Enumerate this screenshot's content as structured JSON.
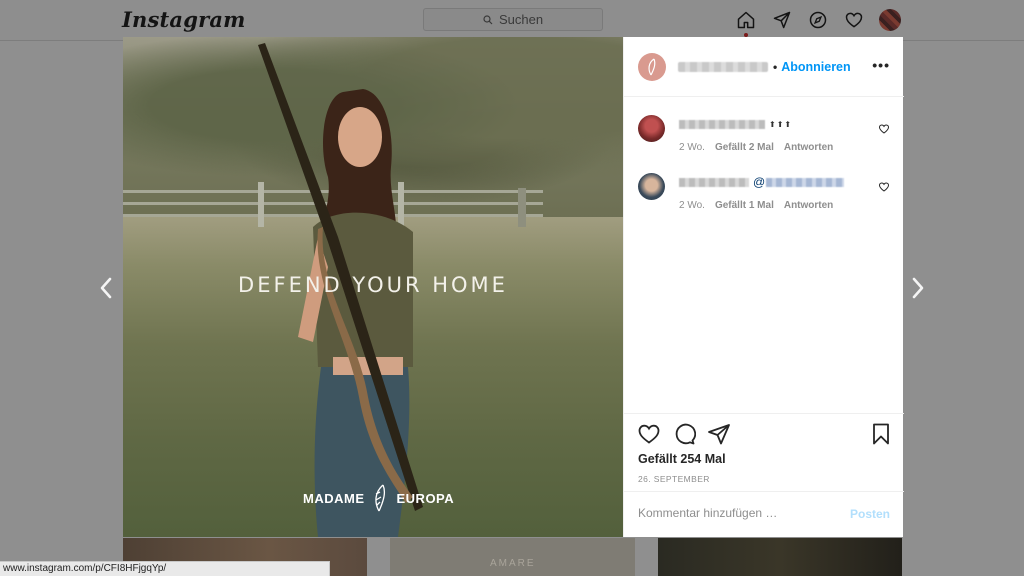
{
  "app": {
    "logo": "Instagram"
  },
  "nav": {
    "search_placeholder": "Suchen",
    "icons": [
      "home-icon",
      "direct-icon",
      "explore-icon",
      "activity-heart-icon",
      "profile-avatar"
    ]
  },
  "post": {
    "image_caption": "DEFEND YOUR HOME",
    "brand_left": "MADAME",
    "brand_right": "EUROPA",
    "follow_label": "Abonnieren",
    "separator": "•",
    "more_label": "•••"
  },
  "comments": [
    {
      "arrows": "⬆⬆⬆",
      "age": "2 Wo.",
      "likes": "Gefällt 2 Mal",
      "reply": "Antworten"
    },
    {
      "mention_prefix": "@",
      "age": "2 Wo.",
      "likes": "Gefällt 1 Mal",
      "reply": "Antworten"
    }
  ],
  "footer": {
    "likes": "Gefällt 254 Mal",
    "date": "26. SEPTEMBER",
    "comment_placeholder": "Kommentar hinzufügen …",
    "post_label": "Posten"
  },
  "grid": {
    "thumb2_text": "AMARE"
  },
  "status_bar": {
    "url": "www.instagram.com/p/CFI8HFjgqYp/"
  },
  "colors": {
    "link_blue": "#0095f6",
    "post_disabled": "#b2dffc",
    "overlay": "#8f8f8f"
  }
}
